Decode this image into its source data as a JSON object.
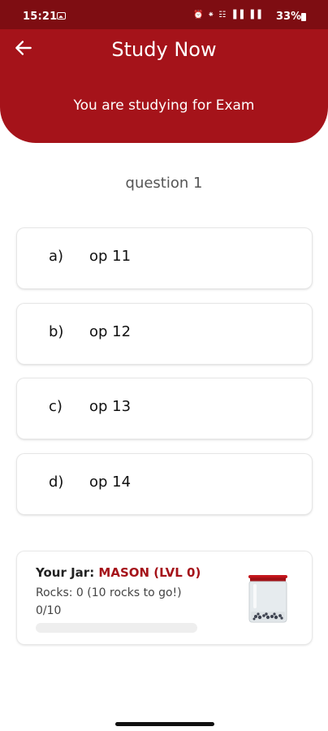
{
  "status": {
    "time": "15:21",
    "battery": "33%",
    "icons": "⏰ ⁕ ☷ ▐▐ ▐▐"
  },
  "header": {
    "title": "Study Now",
    "subtitle": "You are studying for Exam"
  },
  "question": {
    "text": "question 1"
  },
  "options": [
    {
      "letter": "a)",
      "text": "op 11"
    },
    {
      "letter": "b)",
      "text": "op 12"
    },
    {
      "letter": "c)",
      "text": "op 13"
    },
    {
      "letter": "d)",
      "text": "op 14"
    }
  ],
  "jar": {
    "label": "Your Jar:",
    "name": "MASON (LVL 0)",
    "rocks_text": "Rocks: 0 (10 rocks to go!)",
    "count_text": "0/10",
    "progress": 0
  },
  "colors": {
    "brand": "#a5131a",
    "status_bar": "#7e0d12"
  },
  "icons": {
    "back": "arrow-left-icon",
    "jar": "jar-icon"
  }
}
